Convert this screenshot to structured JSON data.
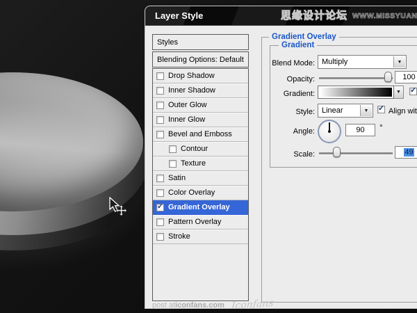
{
  "canvas": {
    "cursor": "move-cursor"
  },
  "watermark_top": {
    "site_name": "思缘设计论坛",
    "site_url": "WWW.MISSYUAN.COM"
  },
  "dialog": {
    "title": "Layer Style",
    "styles_panel": {
      "header_label": "Styles",
      "blending_label": "Blending Options: Default",
      "items": [
        {
          "label": "Drop Shadow",
          "checked": false,
          "indented": false,
          "selected": false
        },
        {
          "label": "Inner Shadow",
          "checked": false,
          "indented": false,
          "selected": false
        },
        {
          "label": "Outer Glow",
          "checked": false,
          "indented": false,
          "selected": false
        },
        {
          "label": "Inner Glow",
          "checked": false,
          "indented": false,
          "selected": false
        },
        {
          "label": "Bevel and Emboss",
          "checked": false,
          "indented": false,
          "selected": false
        },
        {
          "label": "Contour",
          "checked": false,
          "indented": true,
          "selected": false
        },
        {
          "label": "Texture",
          "checked": false,
          "indented": true,
          "selected": false
        },
        {
          "label": "Satin",
          "checked": false,
          "indented": false,
          "selected": false
        },
        {
          "label": "Color Overlay",
          "checked": false,
          "indented": false,
          "selected": false
        },
        {
          "label": "Gradient Overlay",
          "checked": true,
          "indented": false,
          "selected": true
        },
        {
          "label": "Pattern Overlay",
          "checked": false,
          "indented": false,
          "selected": false
        },
        {
          "label": "Stroke",
          "checked": false,
          "indented": false,
          "selected": false
        }
      ]
    },
    "settings": {
      "group_title": "Gradient Overlay",
      "subgroup_title": "Gradient",
      "blend_mode_label": "Blend Mode:",
      "blend_mode_value": "Multiply",
      "opacity_label": "Opacity:",
      "opacity_value": "100",
      "gradient_label": "Gradient:",
      "style_label": "Style:",
      "style_value": "Linear",
      "align_label": "Align with",
      "angle_label": "Angle:",
      "angle_value": "90",
      "angle_unit": "°",
      "scale_label": "Scale:",
      "scale_value": "49"
    },
    "watermark_bottom": {
      "prefix": "post at ",
      "site": "iconfans.com",
      "signature": "Iconfans"
    }
  },
  "colors": {
    "selection_blue": "#3566d7",
    "heading_blue": "#1a56c8",
    "dialog_bg": "#ececec",
    "titlebar_bg": "#0d0d0d"
  }
}
